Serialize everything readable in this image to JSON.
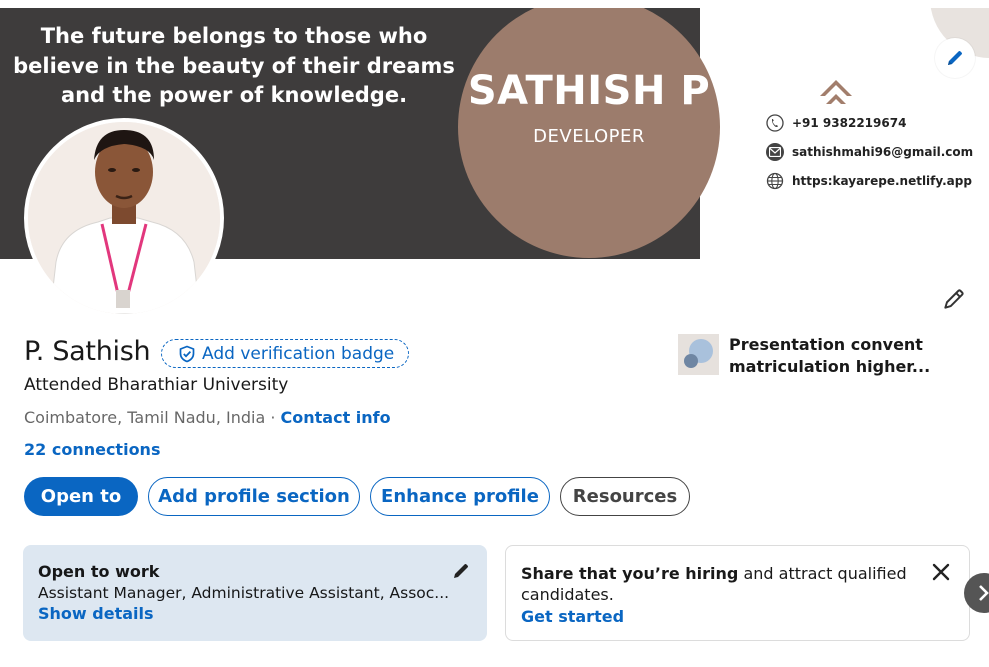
{
  "banner": {
    "quote": "The future belongs to those who believe in the beauty of their dreams and the power of knowledge.",
    "name": "SATHISH P",
    "role": "DEVELOPER",
    "phone": "+91 9382219674",
    "email": "sathishmahi96@gmail.com",
    "website": "https:kayarepe.netlify.app"
  },
  "profile": {
    "name": "P. Sathish",
    "verification_label": "Add verification badge",
    "headline": "Attended Bharathiar University",
    "location": "Coimbatore, Tamil Nadu, India",
    "separator": " · ",
    "contact_info": "Contact info",
    "connections": "22 connections",
    "education": "Presentation convent matriculation higher..."
  },
  "actions": {
    "open_to": "Open to",
    "add_profile_section": "Add profile section",
    "enhance_profile": "Enhance profile",
    "resources": "Resources"
  },
  "open_to_work": {
    "title": "Open to work",
    "roles": "Assistant Manager, Administrative Assistant, Assoc...",
    "link": "Show details"
  },
  "hiring": {
    "bold": "Share that you’re hiring",
    "rest": " and attract qualified candidates.",
    "link": "Get started"
  },
  "colors": {
    "brand_blue": "#0a66c2",
    "banner_dark": "#3e3c3c",
    "banner_circle": "#9c7c6c",
    "otw_bg": "#dde7f1"
  },
  "icons": [
    "pencil-icon",
    "shield-check-icon",
    "phone-icon",
    "mail-icon",
    "globe-icon",
    "close-icon",
    "chevron-right-icon"
  ]
}
